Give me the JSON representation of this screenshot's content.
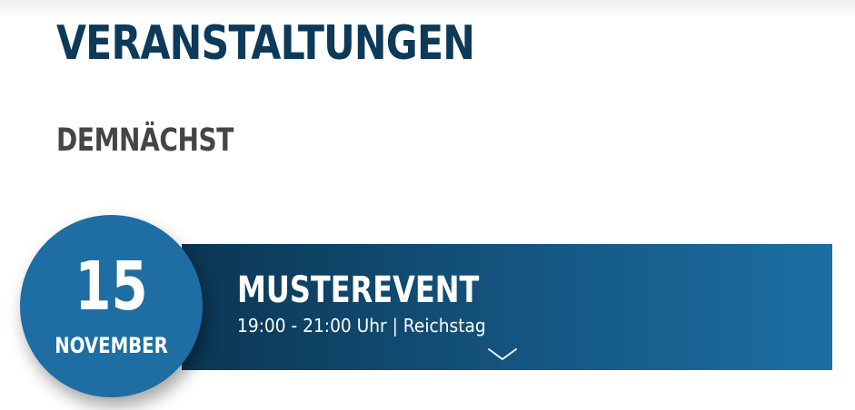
{
  "page": {
    "title": "VERANSTALTUNGEN",
    "section_title": "DEMNÄCHST"
  },
  "events": [
    {
      "day": "15",
      "month": "NOVEMBER",
      "title": "MUSTEREVENT",
      "meta": "19:00 - 21:00 Uhr | Reichstag",
      "expand_icon": "chevron-down-icon"
    }
  ],
  "colors": {
    "heading": "#0d3a59",
    "subheading": "#454545",
    "date_circle": "#1e6ea4",
    "bar_gradient_start": "#0b3653",
    "bar_gradient_end": "#1c6fa3"
  }
}
